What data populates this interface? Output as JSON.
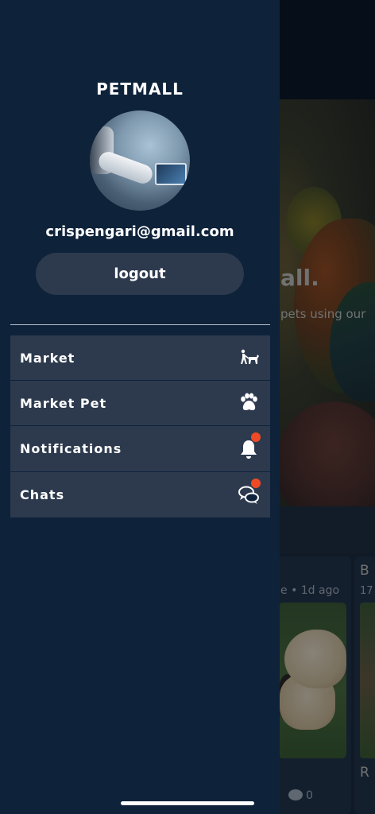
{
  "background": {
    "hero_title": "all.",
    "hero_subtitle": "pets using our",
    "card": {
      "meta": "e • 1d ago",
      "comment_count": "0"
    },
    "card2": {
      "title_letter": "B",
      "meta": "17",
      "subtitle_letter": "R"
    }
  },
  "drawer": {
    "app_title": "PETMALL",
    "email": "crispengari@gmail.com",
    "logout_label": "logout",
    "menu": [
      {
        "label": "Market",
        "icon": "dog-walking-icon",
        "badge": false
      },
      {
        "label": "Market Pet",
        "icon": "paw-icon",
        "badge": false
      },
      {
        "label": "Notifications",
        "icon": "bell-icon",
        "badge": true
      },
      {
        "label": "Chats",
        "icon": "chat-bubbles-icon",
        "badge": true
      }
    ]
  },
  "colors": {
    "drawer_bg": "#0e223a",
    "menu_item_bg": "#2d3a4e",
    "badge": "#ef4a26"
  }
}
